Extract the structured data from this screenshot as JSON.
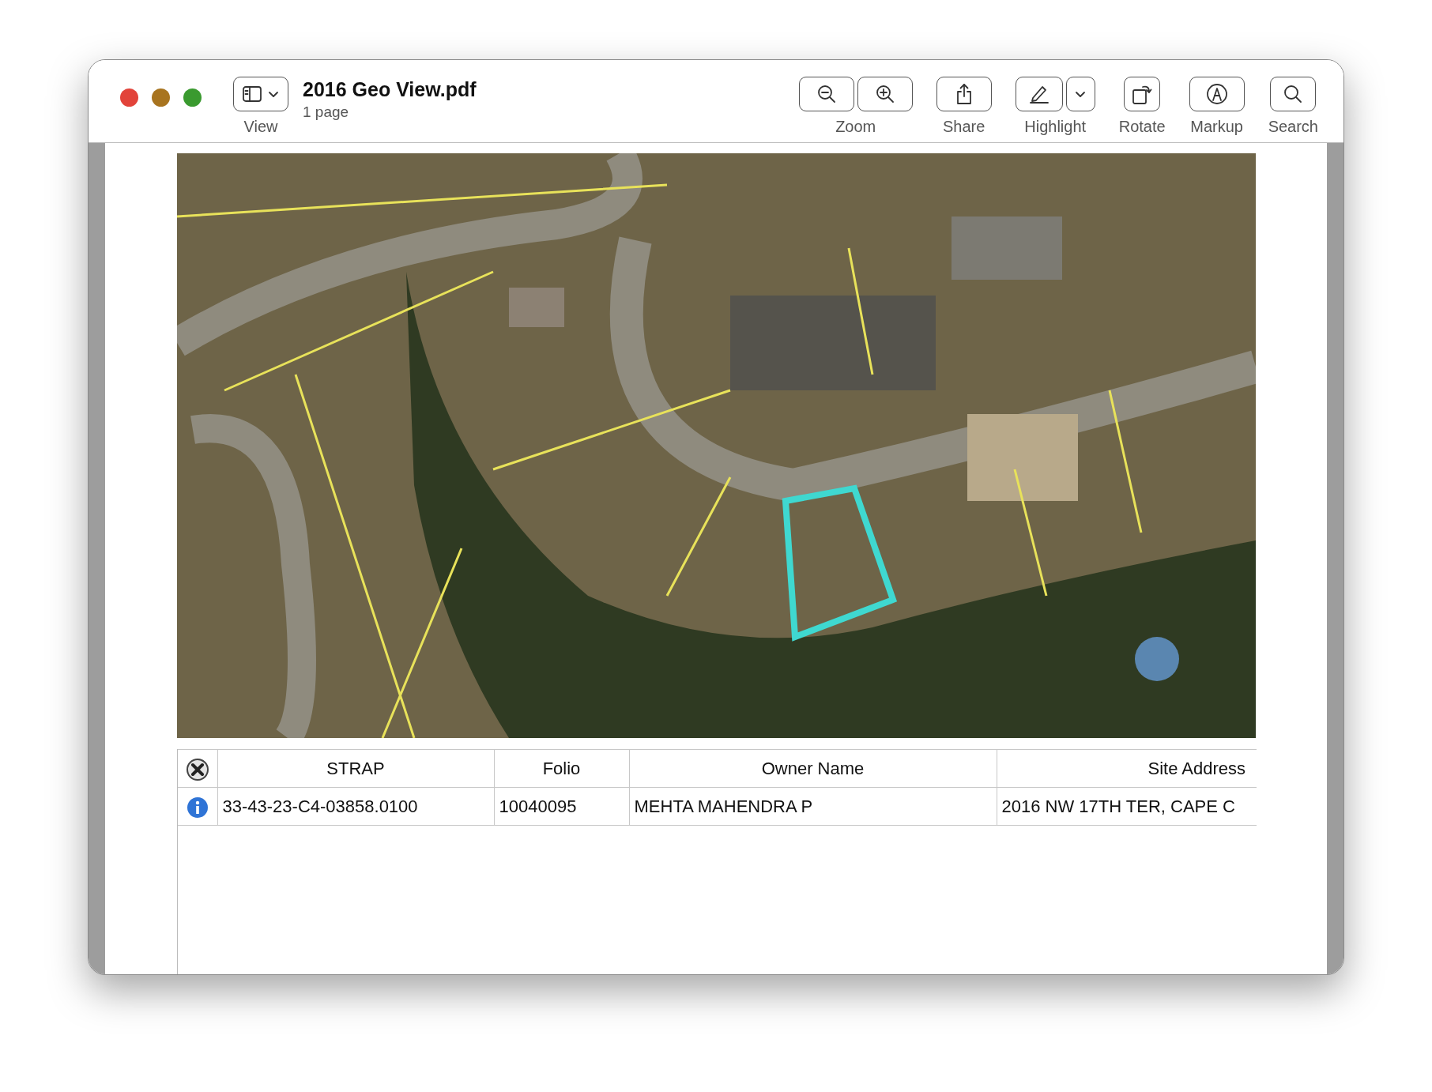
{
  "window": {
    "title": "2016 Geo View.pdf",
    "subtitle": "1 page",
    "traffic_lights": [
      {
        "color": "#e2433a"
      },
      {
        "color": "#a8741f"
      },
      {
        "color": "#3a9a2f"
      }
    ]
  },
  "toolbar": [
    {
      "kind": "view",
      "label": "View"
    },
    {
      "kind": "zoom",
      "label": "Zoom"
    },
    {
      "kind": "share",
      "label": "Share"
    },
    {
      "kind": "highlight",
      "label": "Highlight"
    },
    {
      "kind": "rotate",
      "label": "Rotate"
    },
    {
      "kind": "markup",
      "label": "Markup"
    },
    {
      "kind": "search",
      "label": "Search"
    }
  ],
  "document": {
    "table": {
      "columns": [
        "STRAP",
        "Folio",
        "Owner Name",
        "Site Address"
      ],
      "rows": [
        [
          "33-43-23-C4-03858.0100",
          "10040095",
          "MEHTA MAHENDRA P",
          "2016 NW 17TH TER, CAPE C"
        ]
      ]
    }
  }
}
